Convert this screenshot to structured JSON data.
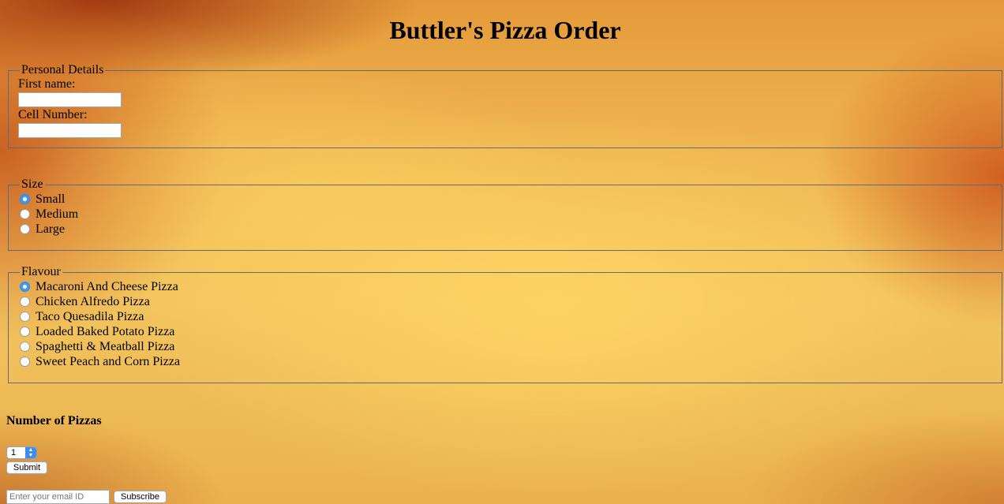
{
  "page": {
    "title": "Buttler's Pizza Order"
  },
  "personal": {
    "legend": "Personal Details",
    "first_name_label": "First name:",
    "first_name_value": "",
    "cell_label": "Cell Number:",
    "cell_value": ""
  },
  "size": {
    "legend": "Size",
    "options": [
      {
        "label": "Small",
        "checked": true
      },
      {
        "label": "Medium",
        "checked": false
      },
      {
        "label": "Large",
        "checked": false
      }
    ]
  },
  "flavour": {
    "legend": "Flavour",
    "options": [
      {
        "label": "Macaroni And Cheese Pizza",
        "checked": true
      },
      {
        "label": "Chicken Alfredo Pizza",
        "checked": false
      },
      {
        "label": "Taco Quesadila Pizza",
        "checked": false
      },
      {
        "label": "Loaded Baked Potato Pizza",
        "checked": false
      },
      {
        "label": "Spaghetti & Meatball Pizza",
        "checked": false
      },
      {
        "label": "Sweet Peach and Corn Pizza",
        "checked": false
      }
    ]
  },
  "quantity": {
    "heading": "Number of Pizzas",
    "selected": "1"
  },
  "buttons": {
    "submit": "Submit",
    "subscribe": "Subscribe"
  },
  "newsletter": {
    "email_placeholder": "Enter your email ID"
  },
  "colors": {
    "radio_checked": "#3b99fc",
    "fieldset_border": "#5d6b7a"
  }
}
